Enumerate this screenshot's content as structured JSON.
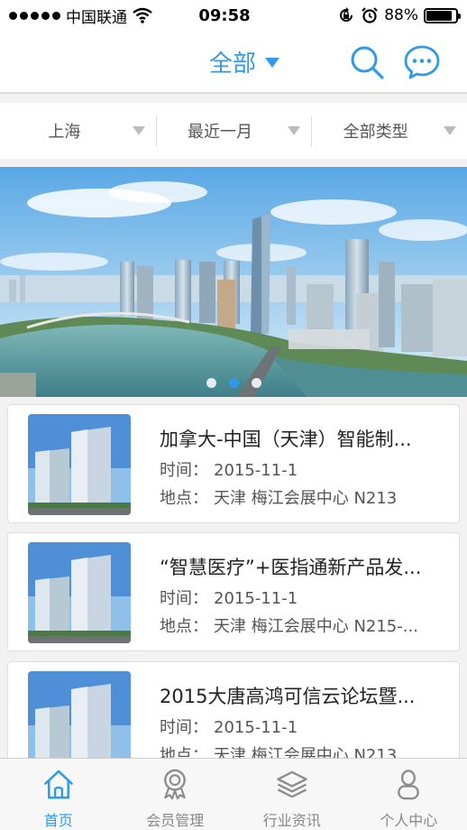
{
  "status_bar": {
    "carrier": "中国联通",
    "time": "09:58",
    "battery_percent": "88%",
    "battery_level": 0.88,
    "icons": [
      "signal-dots-icon",
      "wifi-icon",
      "orientation-lock-icon",
      "alarm-icon",
      "battery-icon"
    ]
  },
  "nav": {
    "title": "全部",
    "icons": [
      "caret-down-icon",
      "search-icon",
      "chat-icon"
    ]
  },
  "filters": [
    {
      "label": "上海"
    },
    {
      "label": "最近一月"
    },
    {
      "label": "全部类型"
    }
  ],
  "banner": {
    "slide_count": 3,
    "active_index": 1
  },
  "events": [
    {
      "title": "加拿大-中国（天津）智能制...",
      "time_label": "时间：",
      "time": "2015-11-1",
      "place_label": "地点：",
      "place": "天津 梅江会展中心 N213"
    },
    {
      "title": "“智慧医疗”+医指通新产品发...",
      "time_label": "时间：",
      "time": "2015-11-1",
      "place_label": "地点：",
      "place": "天津 梅江会展中心 N215-..."
    },
    {
      "title": "2015大唐高鸿可信云论坛暨...",
      "time_label": "时间：",
      "time": "2015-11-1",
      "place_label": "地点：",
      "place": "天津 梅江会展中心 N213"
    }
  ],
  "tabs": [
    {
      "label": "首页",
      "icon": "home-icon",
      "active": true
    },
    {
      "label": "会员管理",
      "icon": "badge-icon",
      "active": false
    },
    {
      "label": "行业资讯",
      "icon": "layers-icon",
      "active": false
    },
    {
      "label": "个人中心",
      "icon": "person-icon",
      "active": false
    }
  ],
  "colors": {
    "accent": "#2f9be8",
    "tab_inactive": "#888888",
    "background": "#f2f2f2"
  }
}
